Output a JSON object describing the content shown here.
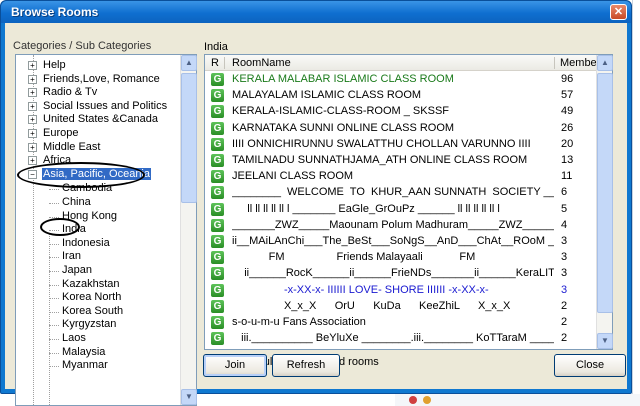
{
  "window": {
    "title": "Browse Rooms",
    "close_glyph": "✕"
  },
  "left": {
    "header": "Categories / Sub Categories",
    "categories": [
      {
        "label": "Help"
      },
      {
        "label": "Friends,Love, Romance"
      },
      {
        "label": "Radio & Tv"
      },
      {
        "label": "Social Issues and Politics"
      },
      {
        "label": "United States &Canada"
      },
      {
        "label": "Europe"
      },
      {
        "label": "Middle East"
      },
      {
        "label": "Africa"
      },
      {
        "label": "Asia, Pacific, Oceania",
        "selected": true
      }
    ],
    "subcategories": [
      "Cambodia",
      "China",
      "Hong Kong",
      "India",
      "Indonesia",
      "Iran",
      "Japan",
      "Kazakhstan",
      "Korea North",
      "Korea South",
      "Kyrgyzstan",
      "Laos",
      "Malaysia",
      "Myanmar"
    ]
  },
  "right": {
    "region": "India",
    "columns": {
      "r": "R",
      "room": "RoomName",
      "members": "Members"
    },
    "rooms": [
      {
        "name": "KERALA MALABAR ISLAMIC CLASS ROOM",
        "members": "96",
        "color": "#1a7a1a"
      },
      {
        "name": "MALAYALAM ISLAMIC CLASS ROOM",
        "members": "57",
        "color": "#000000"
      },
      {
        "name": "KERALA-ISLAMIC-CLASS-ROOM _ SKSSF",
        "members": "49",
        "color": "#000000"
      },
      {
        "name": "KARNATAKA SUNNI ONLINE CLASS ROOM",
        "members": "26",
        "color": "#000000"
      },
      {
        "name": "IIII ONNICHIRUNNU SWALATTHU CHOLLAN VARUNNO IIII",
        "members": "20",
        "color": "#000000"
      },
      {
        "name": "TAMILNADU SUNNATHJAMA_ATH ONLINE CLASS ROOM",
        "members": "13",
        "color": "#000000"
      },
      {
        "name": "JEELANI CLASS ROOM",
        "members": "11",
        "color": "#000000"
      },
      {
        "name": "________  WELCOME  TO  KHUR_AAN SUNNATH  SOCIETY ____",
        "members": "6",
        "color": "#000000"
      },
      {
        "name": "     ll ll ll ll ll l _______ EaGle_GrOuPz ______ ll ll ll ll ll l",
        "members": "5",
        "color": "#000000"
      },
      {
        "name": "_______ZWZ_____Maounam Polum Madhuram_____ZWZ_______",
        "members": "4",
        "color": "#000000"
      },
      {
        "name": "ii__MAiLAnChi___The_BeSt___SoNgS__AnD___ChAt__ROoM ___ii",
        "members": "3",
        "color": "#000000"
      },
      {
        "name": "            FM                 Friends Malayaali            FM",
        "members": "3",
        "color": "#000000"
      },
      {
        "name": "    ii______RocK______ii______FrieNDs_______ii______KeraLITEs_______ii",
        "members": "3",
        "color": "#000000"
      },
      {
        "name": "                 -x-XX-x- IIIIII LOVE- SHORE IIIIII -x-XX-x-",
        "members": "3",
        "color": "#1a1ad0"
      },
      {
        "name": "                 X_x_X      OrU      KuDa      KeeZhiL      X_x_X",
        "members": "2",
        "color": "#000000"
      },
      {
        "name": "s-o-u-m-u Fans Association",
        "members": "2",
        "color": "#000000"
      },
      {
        "name": "   iii.__________ BeYluXe ________.iii.________ KoTTaraM ________.iii",
        "members": "2",
        "color": "#000000"
      }
    ],
    "row_icon": "G"
  },
  "controls": {
    "show_adult_label": "Show adult and restricted rooms",
    "join_label": "Join",
    "refresh_label": "Refresh",
    "close_label": "Close"
  }
}
